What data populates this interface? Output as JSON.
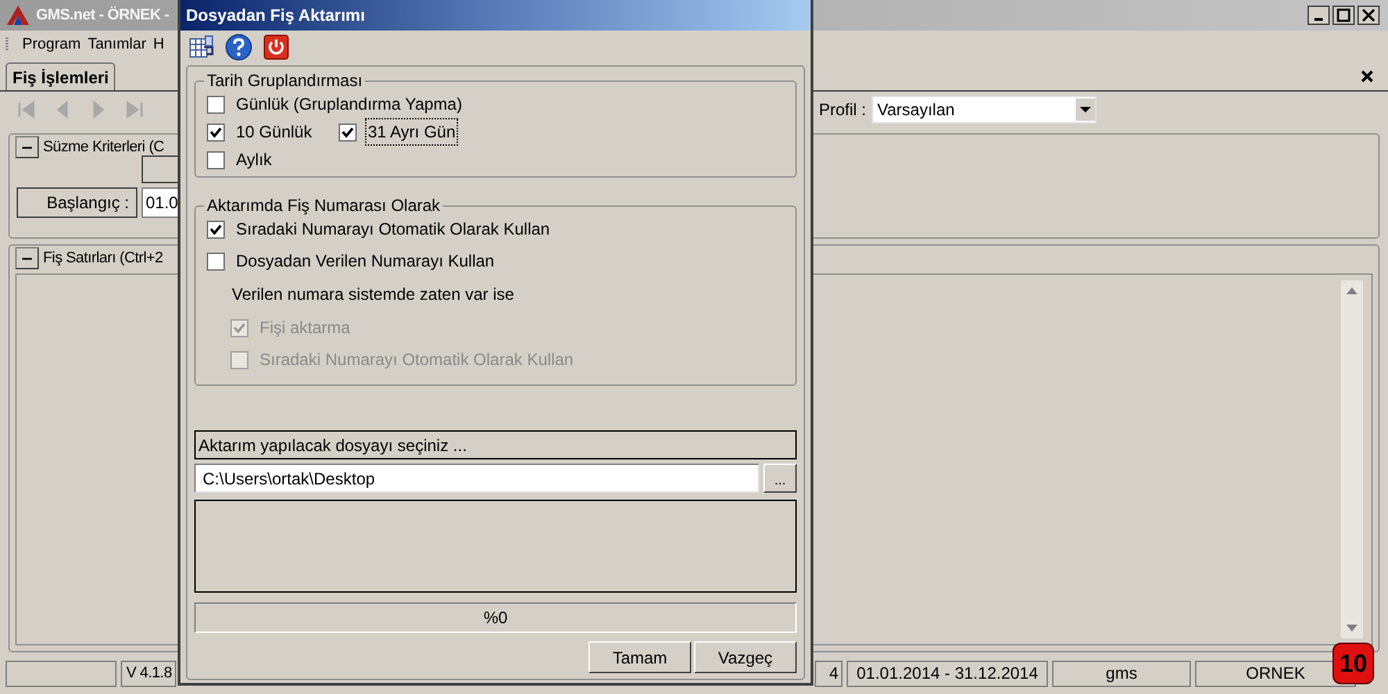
{
  "main_window": {
    "title": "GMS.net - ÖRNEK -",
    "menu": [
      "Program",
      "Tanımlar",
      "H"
    ],
    "tabs": [
      {
        "label": "Fiş İşlemleri",
        "selected": true
      }
    ],
    "profile": {
      "label": "Profil :",
      "value": "Varsayılan"
    },
    "filter_section": {
      "title": "Süzme Kriterleri (C",
      "expanded": true,
      "start_label": "Başlangıç :",
      "start_value": "01.0"
    },
    "lines_section": {
      "title": "Fiş Satırları (Ctrl+2",
      "expanded": true
    },
    "status_bar": [
      {
        "text": "V 4.1.8"
      },
      {
        "text": "4"
      },
      {
        "text": "01.01.2014 - 31.12.2014"
      },
      {
        "text": "gms"
      },
      {
        "text": "ORNEK"
      }
    ],
    "badge": "10"
  },
  "dialog": {
    "title": "Dosyadan Fiş Aktarımı",
    "date_group": {
      "title": "Tarih Gruplandırması",
      "options": [
        {
          "label": "Günlük (Gruplandırma Yapma)",
          "checked": false,
          "focused": false
        },
        {
          "label": "10 Günlük",
          "checked": true,
          "focused": false
        },
        {
          "label": "31 Ayrı Gün",
          "checked": true,
          "focused": true
        },
        {
          "label": "Aylık",
          "checked": false,
          "focused": false
        }
      ]
    },
    "number_group": {
      "title": "Aktarımda Fiş Numarası Olarak",
      "options": [
        {
          "label": "Sıradaki Numarayı Otomatik Olarak Kullan",
          "checked": true,
          "disabled": false
        },
        {
          "label": "Dosyadan Verilen Numarayı Kullan",
          "checked": false,
          "disabled": false
        }
      ],
      "note": "Verilen numara sistemde zaten var ise",
      "sub_options": [
        {
          "label": "Fişi aktarma",
          "checked": true,
          "disabled": true
        },
        {
          "label": "Sıradaki Numarayı Otomatik Olarak Kullan",
          "checked": false,
          "disabled": true
        }
      ]
    },
    "file_prompt": "Aktarım yapılacak dosyayı seçiniz ...",
    "file_path": "C:\\Users\\ortak\\Desktop",
    "browse_button": "...",
    "progress": {
      "level": 0,
      "label": "%0"
    },
    "buttons": [
      "Tamam",
      "Vazgeç"
    ]
  }
}
